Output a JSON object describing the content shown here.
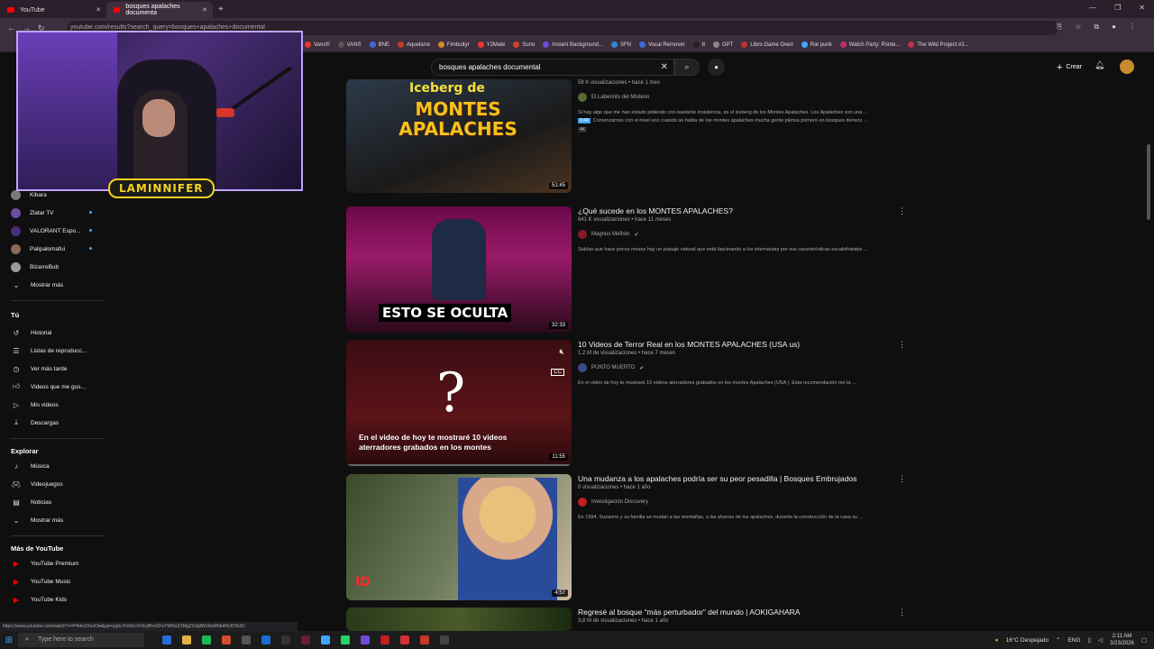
{
  "browser": {
    "tabs": [
      {
        "label": "YouTube",
        "active": false
      },
      {
        "label": "bosques apalaches documenta",
        "active": true
      }
    ],
    "url": "youtube.com/results?search_query=bosques+apalaches+documental",
    "bookmarks": [
      "Vans®",
      "VANS",
      "BNE",
      "Aquelarre",
      "Fimbultyr",
      "Y2Mate",
      "Suno",
      "Instant Background...",
      "SFN",
      "Vocal Remover",
      "tt",
      "GPT",
      "Libro Game Overl",
      "Rat punk",
      "Watch Party: Ponte...",
      "The Wild Project #2..."
    ]
  },
  "header": {
    "search_value": "bosques apalaches documental",
    "create_label": "Crear"
  },
  "overlay": {
    "streamer_name": "LAMINNIFER"
  },
  "sidebar": {
    "subs": [
      {
        "label": "Kibara",
        "color": "#7a7a7a"
      },
      {
        "label": "Zlatar TV",
        "color": "#6b4fa0",
        "live": true
      },
      {
        "label": "VALORANT Espo...",
        "color": "#4a2d7a",
        "live": true
      },
      {
        "label": "Palipalomafui",
        "color": "#8a6a5a",
        "live": true
      },
      {
        "label": "BizarreBub",
        "color": "#9a9a9a"
      }
    ],
    "show_more": "Mostrar más",
    "you_heading": "Tú",
    "you_items": [
      "Historial",
      "Listas de reproducc...",
      "Ver más tarde",
      "Videos que me gus...",
      "Mis videos",
      "Descargas"
    ],
    "explore_heading": "Explorar",
    "explore_items": [
      "Música",
      "Videojuegos",
      "Noticias",
      "Mostrar más"
    ],
    "more_heading": "Más de YouTube",
    "more_items": [
      "YouTube Premium",
      "YouTube Music",
      "YouTube Kids"
    ]
  },
  "videos": [
    {
      "title": "",
      "stats": "58 K visualizaciones • hace 1 mes",
      "channel": "El Laberinto del Misterio",
      "verified": false,
      "desc": "Si hay algo que me han estado pidiendo con bastante insistencia, es el iceberg de los Montes Apalaches. Los Apalaches son una ...",
      "chapter": "0:44",
      "chapter_text": "Comenzamos con el nivel uno cuando se habla de los montes apalaches mucha gente piensa primero en bosques densos ...",
      "badge": "4K",
      "duration": "51:45",
      "thumb_text": "MONTES APALACHES",
      "thumb_sub": "Iceberg de"
    },
    {
      "title": "¿Qué sucede en los MONTES APALACHES?",
      "stats": "641 K visualizaciones • hace 11 meses",
      "channel": "Magnus Mefisto",
      "verified": true,
      "desc": "Sabías que hace pocos meses hay un paisaje natural que está fascinando a los internautas por sus características escalofriantes ...",
      "duration": "32:33",
      "thumb_text": "ESTO SE OCULTA"
    },
    {
      "title": "10 Videos de Terror Real en los MONTES APALACHES (USA us)",
      "stats": "1,2 M de visualizaciones • hace 7 meses",
      "channel": "PUNTO MUERTO",
      "verified": true,
      "desc": "En el video de hoy te mostraré 10 videos aterradores grabados en los montes Apalaches (USA ). Esta recomendación me la ...",
      "duration": "11:55",
      "thumb_text": "En el video de hoy te mostraré 10 videos aterradores grabados en los montes",
      "thumb_q": "?"
    },
    {
      "title": "Una mudanza a los apalaches podría ser su peor pesadilla | Bosques Embrujados",
      "stats": "0 visualizaciones • hace 1 año",
      "channel": "Investigación Discovery",
      "verified": false,
      "desc": "En 1994, Suzanne y su familia se mudan a las montañas, a las afueras de los apalaches, durante la construcción de la casa su ...",
      "duration": "4:57",
      "thumb_text": "ID"
    },
    {
      "title": "Regresé al bosque “más perturbador” del mundo | AOKIGAHARA",
      "stats": "3,8 M de visualizaciones • hace 1 año"
    }
  ],
  "statusbar": "https://www.youtube.com/watch?v=P4rkv15ooOw&pp=ygUcYm9zcXVlcyBhcGFsYWNoZXMgZG9jdW1lbnRhbA%3D%3D",
  "taskbar": {
    "search_placeholder": "Type here to search",
    "weather": "16°C Despejado",
    "lang": "ENG",
    "time": "2:11 AM",
    "date": "3/23/2026"
  },
  "colors": {
    "bg": "#0f0f0f",
    "accent": "#ff0000",
    "link": "#3ea6ff"
  }
}
